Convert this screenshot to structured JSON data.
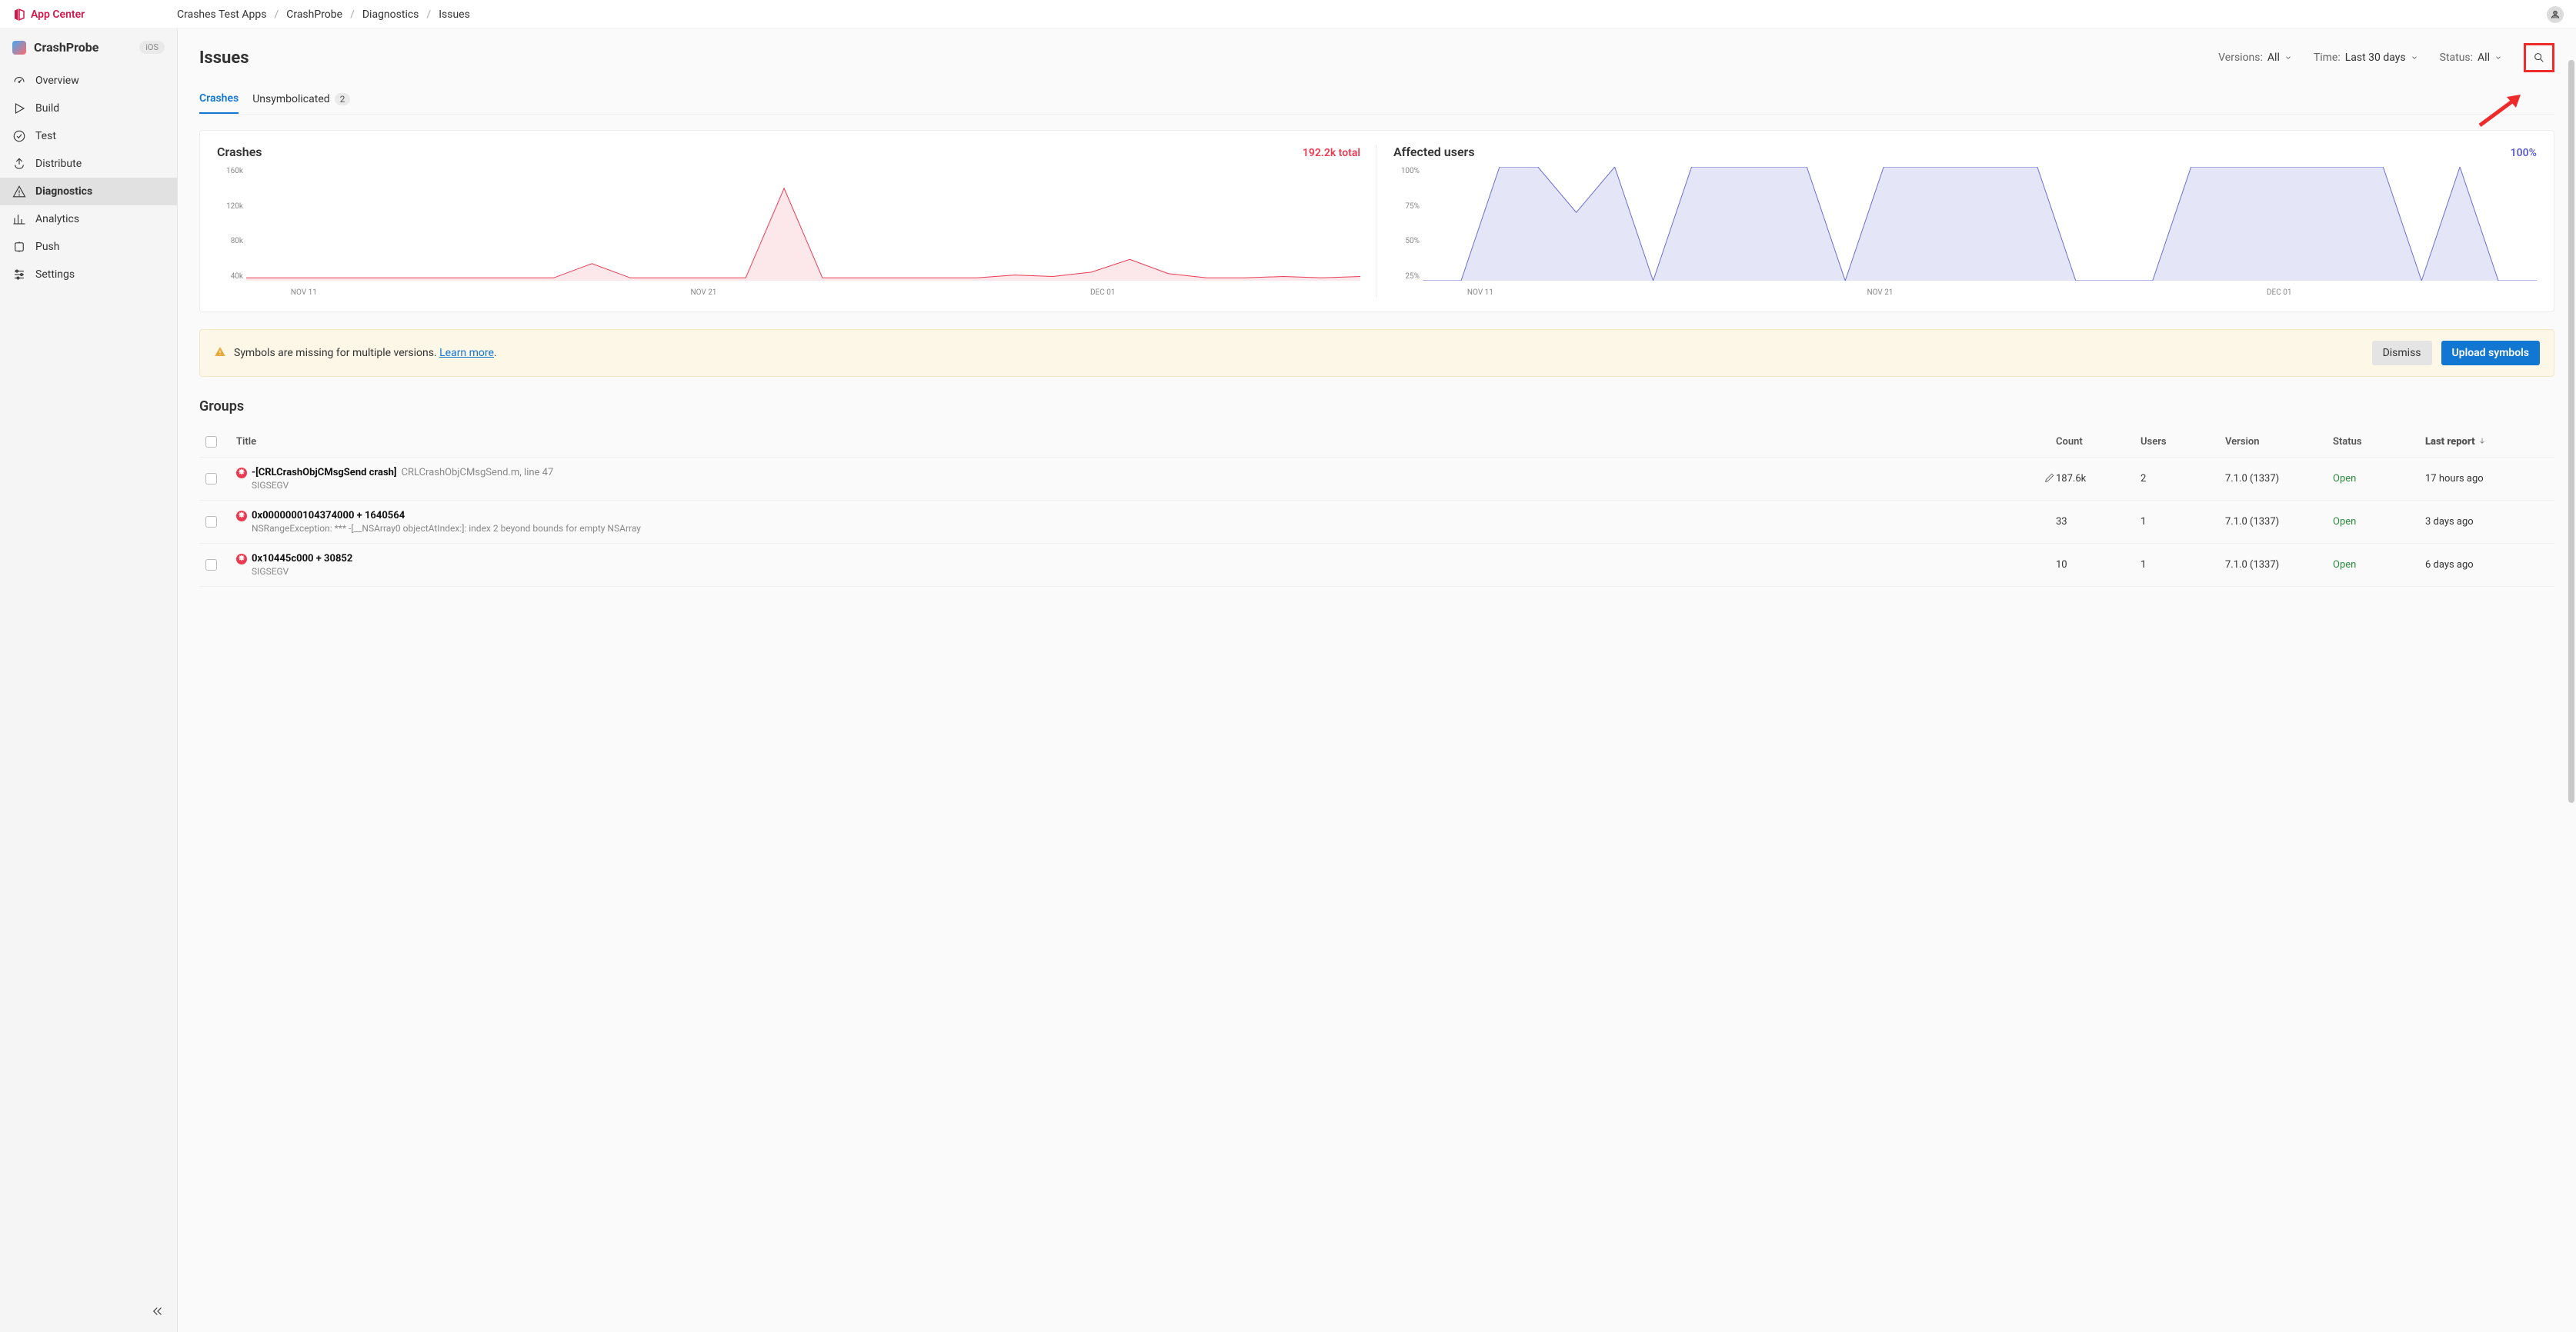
{
  "brand": "App Center",
  "breadcrumb": [
    "Crashes Test Apps",
    "CrashProbe",
    "Diagnostics",
    "Issues"
  ],
  "app": {
    "name": "CrashProbe",
    "platform": "iOS"
  },
  "sidebar": {
    "items": [
      {
        "label": "Overview"
      },
      {
        "label": "Build"
      },
      {
        "label": "Test"
      },
      {
        "label": "Distribute"
      },
      {
        "label": "Diagnostics"
      },
      {
        "label": "Analytics"
      },
      {
        "label": "Push"
      },
      {
        "label": "Settings"
      }
    ]
  },
  "page": {
    "title": "Issues"
  },
  "filters": {
    "versions_label": "Versions:",
    "versions_value": "All",
    "time_label": "Time:",
    "time_value": "Last 30 days",
    "status_label": "Status:",
    "status_value": "All"
  },
  "tabs": {
    "crashes": "Crashes",
    "unsymbolicated": "Unsymbolicated",
    "unsymbolicated_count": "2"
  },
  "charts": {
    "crashes": {
      "title": "Crashes",
      "total": "192.2k total"
    },
    "users": {
      "title": "Affected users",
      "total": "100%"
    }
  },
  "chart_data": [
    {
      "type": "area",
      "title": "Crashes",
      "ylabel": "",
      "xlabel": "",
      "y_ticks": [
        "160k",
        "120k",
        "80k",
        "40k"
      ],
      "x_ticks": [
        "NOV 11",
        "NOV 21",
        "DEC 01"
      ],
      "ylim": [
        0,
        160000
      ],
      "x_index": [
        0,
        1,
        2,
        3,
        4,
        5,
        6,
        7,
        8,
        9,
        10,
        11,
        12,
        13,
        14,
        15,
        16,
        17,
        18,
        19,
        20,
        21,
        22,
        23,
        24,
        25,
        26,
        27,
        28,
        29
      ],
      "values": [
        4000,
        4000,
        4000,
        4000,
        4000,
        4000,
        4000,
        4000,
        4000,
        24000,
        4000,
        4000,
        4000,
        4000,
        130000,
        4000,
        4000,
        4000,
        4000,
        4000,
        8000,
        6000,
        12000,
        30000,
        10000,
        4000,
        4000,
        6000,
        4000,
        6000
      ]
    },
    {
      "type": "area",
      "title": "Affected users",
      "ylabel": "",
      "xlabel": "",
      "y_ticks": [
        "100%",
        "75%",
        "50%",
        "25%"
      ],
      "x_ticks": [
        "NOV 11",
        "NOV 21",
        "DEC 01"
      ],
      "ylim": [
        0,
        100
      ],
      "x_index": [
        0,
        1,
        2,
        3,
        4,
        5,
        6,
        7,
        8,
        9,
        10,
        11,
        12,
        13,
        14,
        15,
        16,
        17,
        18,
        19,
        20,
        21,
        22,
        23,
        24,
        25,
        26,
        27,
        28,
        29
      ],
      "values": [
        0,
        0,
        100,
        100,
        60,
        100,
        0,
        100,
        100,
        100,
        100,
        0,
        100,
        100,
        100,
        100,
        100,
        0,
        0,
        0,
        100,
        100,
        100,
        100,
        100,
        100,
        0,
        100,
        0,
        0
      ]
    }
  ],
  "alert": {
    "text_pre": "Symbols are missing for multiple versions. ",
    "link": "Learn more",
    "text_post": ".",
    "dismiss": "Dismiss",
    "upload": "Upload symbols"
  },
  "groups": {
    "title": "Groups"
  },
  "columns": {
    "title": "Title",
    "count": "Count",
    "users": "Users",
    "version": "Version",
    "status": "Status",
    "last": "Last report"
  },
  "rows": [
    {
      "sig": "-[CRLCrashObjCMsgSend crash]",
      "file": "CRLCrashObjCMsgSend.m, line 47",
      "sub": "SIGSEGV",
      "count": "187.6k",
      "users": "2",
      "version": "7.1.0 (1337)",
      "status": "Open",
      "last": "17 hours ago",
      "editable": true
    },
    {
      "sig": "0x0000000104374000 + 1640564",
      "file": "",
      "sub": "NSRangeException: *** -[__NSArray0 objectAtIndex:]: index 2 beyond bounds for empty NSArray",
      "count": "33",
      "users": "1",
      "version": "7.1.0 (1337)",
      "status": "Open",
      "last": "3 days ago"
    },
    {
      "sig": "0x10445c000 + 30852",
      "file": "",
      "sub": "SIGSEGV",
      "count": "10",
      "users": "1",
      "version": "7.1.0 (1337)",
      "status": "Open",
      "last": "6 days ago"
    }
  ]
}
